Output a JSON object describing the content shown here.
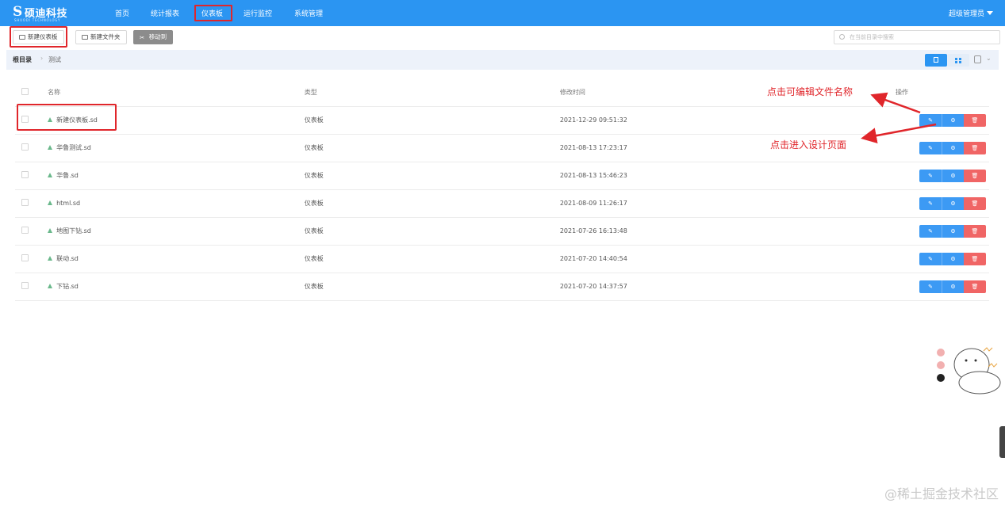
{
  "brand": {
    "logo_mark": "S",
    "name": "硕迪科技",
    "tagline": "SHUODI TECHNOLOGY"
  },
  "nav": {
    "items": [
      {
        "label": "首页"
      },
      {
        "label": "统计报表"
      },
      {
        "label": "仪表板",
        "active": true
      },
      {
        "label": "运行监控"
      },
      {
        "label": "系统管理"
      }
    ],
    "user": "超级管理员"
  },
  "toolbar": {
    "new_dashboard": "新建仪表板",
    "new_folder": "新建文件夹",
    "move_to": "移动到",
    "search_placeholder": "在当前目录中搜索"
  },
  "breadcrumb": {
    "root": "根目录",
    "separator": "›",
    "current": "测试"
  },
  "table": {
    "headers": {
      "name": "名称",
      "type": "类型",
      "modified": "修改时间",
      "actions": "操作"
    },
    "rows": [
      {
        "name": "新建仪表板.sd",
        "type": "仪表板",
        "modified": "2021-12-29 09:51:32"
      },
      {
        "name": "华鲁测试.sd",
        "type": "仪表板",
        "modified": "2021-08-13 17:23:17"
      },
      {
        "name": "华鲁.sd",
        "type": "仪表板",
        "modified": "2021-08-13 15:46:23"
      },
      {
        "name": "html.sd",
        "type": "仪表板",
        "modified": "2021-08-09 11:26:17"
      },
      {
        "name": "地图下钻.sd",
        "type": "仪表板",
        "modified": "2021-07-26 16:13:48"
      },
      {
        "name": "联动.sd",
        "type": "仪表板",
        "modified": "2021-07-20 14:40:54"
      },
      {
        "name": "下钻.sd",
        "type": "仪表板",
        "modified": "2021-07-20 14:37:57"
      }
    ]
  },
  "annotations": {
    "edit_name": "点击可编辑文件名称",
    "enter_design": "点击进入设计页面"
  },
  "watermark": "@稀土掘金技术社区",
  "colors": {
    "topbar": "#2b95f2",
    "highlight": "#e0262b",
    "action_blue": "#3c9af4",
    "action_red": "#f06565"
  },
  "icons": {
    "file": "dashboard-file-icon",
    "edit": "pencil-icon",
    "design": "gear-icon",
    "delete": "trash-icon"
  }
}
